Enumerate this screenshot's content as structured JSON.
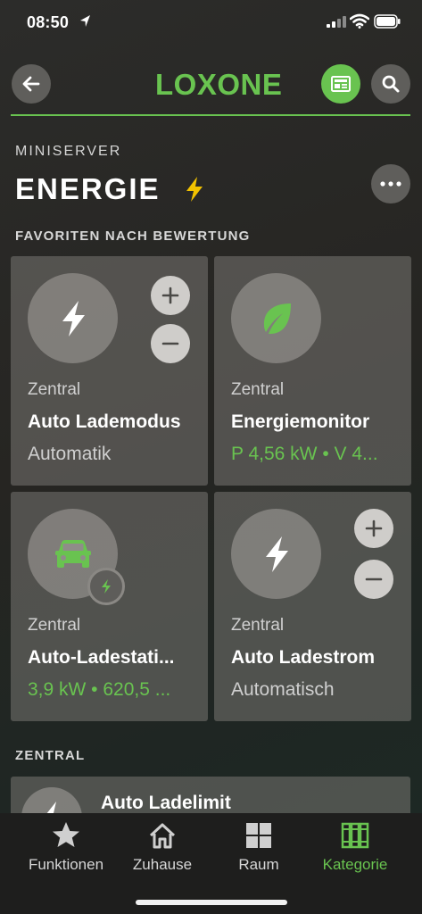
{
  "status_bar": {
    "time": "08:50"
  },
  "header": {
    "logo": "LOXONE"
  },
  "page": {
    "subtitle": "MINISERVER",
    "title": "ENERGIE"
  },
  "sections": {
    "favorites": "FAVORITEN NACH BEWERTUNG",
    "zentral": "ZENTRAL"
  },
  "cards": [
    {
      "room": "Zentral",
      "name": "Auto Lademodus",
      "state": "Automatik",
      "icon": "lightning-icon"
    },
    {
      "room": "Zentral",
      "name": "Energiemonitor",
      "state": "P 4,56 kW • V 4...",
      "icon": "leaf-icon"
    },
    {
      "room": "Zentral",
      "name": "Auto-Ladestati...",
      "state": "3,9 kW • 620,5 ...",
      "icon": "car-icon"
    },
    {
      "room": "Zentral",
      "name": "Auto Ladestrom",
      "state": "Automatisch",
      "icon": "lightning-icon"
    }
  ],
  "list": [
    {
      "name": "Auto Ladelimit",
      "icon": "lightning-icon"
    }
  ],
  "tabbar": [
    {
      "label": "Funktionen",
      "icon": "star-icon"
    },
    {
      "label": "Zuhause",
      "icon": "house-icon"
    },
    {
      "label": "Raum",
      "icon": "grid-icon"
    },
    {
      "label": "Kategorie",
      "icon": "category-icon",
      "active": true
    }
  ],
  "colors": {
    "accent": "#69c350",
    "card": "#6f6d69",
    "button": "#5f5e5b"
  }
}
